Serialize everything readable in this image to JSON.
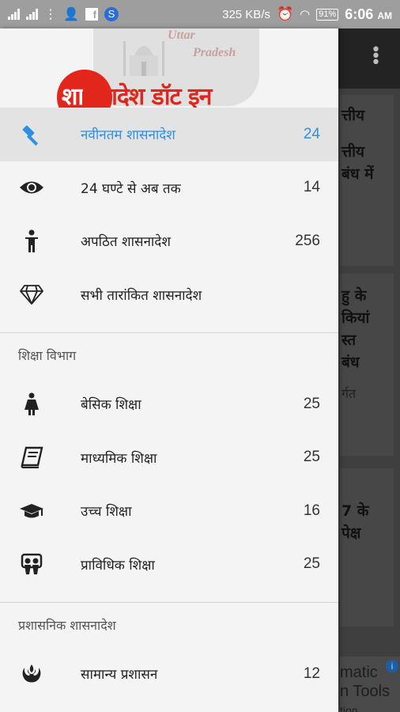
{
  "status_bar": {
    "network_speed": "325 KB/s",
    "battery": "91%",
    "time": "6:06",
    "ampm": "AM"
  },
  "header": {
    "logo_text_white": "शा",
    "logo_text_red": "सनादेश डॉट इन",
    "region_line1": "Uttar",
    "region_line2": "Pradesh"
  },
  "drawer": {
    "top_items": [
      {
        "icon": "gavel-icon",
        "label": "नवीनतम शासनादेश",
        "count": "24",
        "active": true
      },
      {
        "icon": "eye-icon",
        "label": "24 घण्टे से अब तक",
        "count": "14",
        "active": false
      },
      {
        "icon": "person-icon",
        "label": "अपठित शासनादेश",
        "count": "256",
        "active": false
      },
      {
        "icon": "diamond-icon",
        "label": "सभी तारांकित शासनादेश",
        "count": "",
        "active": false
      }
    ],
    "section_education": "शिक्षा विभाग",
    "education_items": [
      {
        "icon": "girl-icon",
        "label": "बेसिक शिक्षा",
        "count": "25"
      },
      {
        "icon": "book-icon",
        "label": "माध्यमिक शिक्षा",
        "count": "25"
      },
      {
        "icon": "graduation-cap-icon",
        "label": "उच्च शिक्षा",
        "count": "16"
      },
      {
        "icon": "slideshare-icon",
        "label": "प्राविधिक शिक्षा",
        "count": "25"
      }
    ],
    "section_admin": "प्रशासनिक शासनादेश",
    "admin_items": [
      {
        "icon": "rebel-icon",
        "label": "सामान्य प्रशासन",
        "count": "12"
      }
    ]
  },
  "background": {
    "card1_line1": "त्तीय",
    "card1_line2": "त्तीय",
    "card1_line3": "बंध में",
    "card2_line1": "हु के",
    "card2_line2": "कियां",
    "card2_line3": "स्त",
    "card2_line4": "बंध",
    "card2_sub": "र्गत",
    "card3_line1": "7 के",
    "card3_line2": "पेक्ष",
    "ad_line1": "matic",
    "ad_line2": "n Tools",
    "ad_line3": "tion"
  },
  "colors": {
    "accent": "#2f8fe0",
    "logo_red": "#e2261c",
    "drawer_bg": "#f4f4f4"
  }
}
